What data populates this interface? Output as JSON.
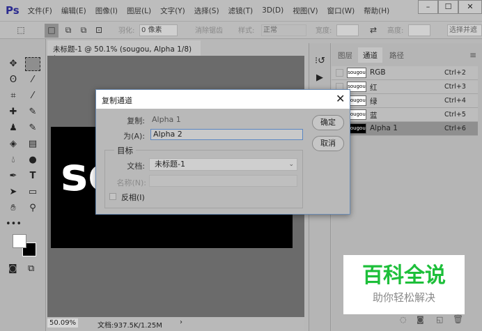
{
  "app": {
    "logo": "Ps",
    "menus": [
      "文件(F)",
      "编辑(E)",
      "图像(I)",
      "图层(L)",
      "文字(Y)",
      "选择(S)",
      "滤镜(T)",
      "3D(D)",
      "视图(V)",
      "窗口(W)",
      "帮助(H)"
    ],
    "win": {
      "min": "–",
      "max": "☐",
      "close": "✕"
    }
  },
  "options": {
    "feather_label": "羽化:",
    "feather_value": "0 像素",
    "antialias": "消除锯齿",
    "style_label": "样式:",
    "style_value": "正常",
    "width_label": "宽度:",
    "height_label": "高度:",
    "select_mask": "选择并遮"
  },
  "document": {
    "tab": "未标题-1 @ 50.1% (sougou, Alpha 1/8) *",
    "canvas_text": "so",
    "zoom": "50.09%",
    "doc_info": "文档:937.5K/1.25M"
  },
  "panel": {
    "tabs": [
      "图层",
      "通道",
      "路径"
    ],
    "channels": [
      {
        "name": "RGB",
        "key": "Ctrl+2",
        "thumb": "sougou"
      },
      {
        "name": "红",
        "key": "Ctrl+3",
        "thumb": "sougou"
      },
      {
        "name": "绿",
        "key": "Ctrl+4",
        "thumb": "sougou"
      },
      {
        "name": "蓝",
        "key": "Ctrl+5",
        "thumb": "sougou"
      },
      {
        "name": "Alpha 1",
        "key": "Ctrl+6",
        "thumb": "sougou"
      }
    ]
  },
  "watermark": {
    "title": "百科全说",
    "subtitle": "助你轻松解决",
    "color": "#1dbf3a"
  },
  "dialog": {
    "title": "复制通道",
    "copy_label": "复制:",
    "copy_value": "Alpha 1",
    "as_label": "为(A):",
    "as_value": "Alpha 2",
    "target_label": "目标",
    "doc_label": "文档:",
    "doc_value": "未标题-1",
    "name_label": "名称(N):",
    "invert_label": "反相(I)",
    "ok": "确定",
    "cancel": "取消"
  }
}
